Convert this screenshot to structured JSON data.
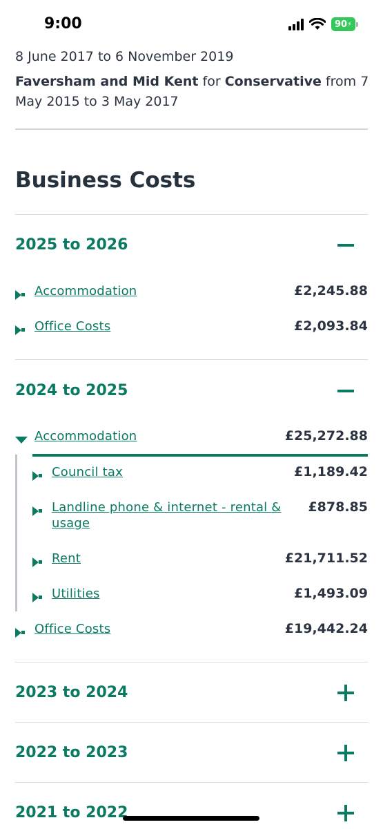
{
  "status": {
    "time": "9:00",
    "battery": "90"
  },
  "intro": {
    "line1": "8 June 2017 to 6 November 2019",
    "constituency": "Faversham and Mid Kent",
    "for_word": "for",
    "party": "Conservative",
    "from_word": "from",
    "line3": "7 May 2015 to 3 May 2017"
  },
  "section_title": "Business Costs",
  "years": [
    {
      "label": "2025 to 2026",
      "items": [
        {
          "label": "Accommodation",
          "amount": "£2,245.88"
        },
        {
          "label": "Office Costs",
          "amount": "£2,093.84"
        }
      ]
    },
    {
      "label": "2024 to 2025",
      "items": [
        {
          "label": "Accommodation",
          "amount": "£25,272.88",
          "children": [
            {
              "label": "Council tax",
              "amount": "£1,189.42"
            },
            {
              "label": "Landline phone & internet - rental &",
              "label2": "usage",
              "amount": "£878.85"
            },
            {
              "label": "Rent",
              "amount": "£21,711.52"
            },
            {
              "label": "Utilities",
              "amount": "£1,493.09"
            }
          ]
        },
        {
          "label": "Office Costs",
          "amount": "£19,442.24"
        }
      ]
    },
    {
      "label": "2023 to 2024"
    },
    {
      "label": "2022 to 2023"
    },
    {
      "label": "2021 to 2022"
    }
  ],
  "colors": {
    "accent": "#0b7a62",
    "text": "#2b3440",
    "battery": "#34c759"
  },
  "icons": {
    "expanded": "minus-icon",
    "collapsed": "plus-icon"
  }
}
